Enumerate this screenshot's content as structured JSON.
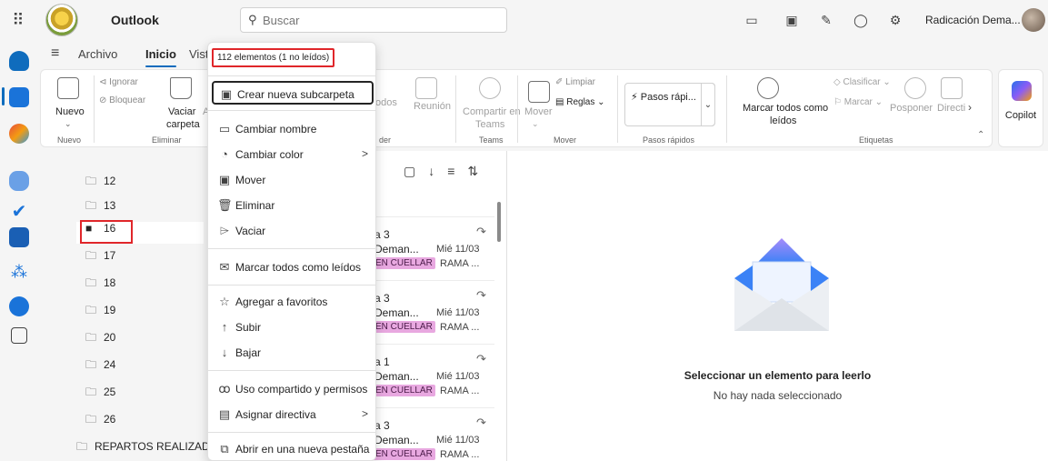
{
  "app": {
    "title": "Outlook",
    "account": "Radicación Dema..."
  },
  "search": {
    "placeholder": "Buscar",
    "icon": "search-icon"
  },
  "ribbon": {
    "tabs": [
      "Archivo",
      "Inicio",
      "Vist"
    ],
    "nuevo": "Nuevo",
    "nuevo_group": "Nuevo",
    "ignorar": "Ignorar",
    "bloquear": "Bloquear",
    "vaciar": "Vaciar",
    "vaciar_carpeta": "carpeta",
    "vaciar_extra": "A",
    "eliminar_group": "Eliminar",
    "todos": "odos",
    "reunion": "Reunión",
    "responder_group": "der",
    "compartir_teams": "Compartir en",
    "compartir_teams2": "Teams",
    "teams_group": "Teams",
    "mover": "Mover",
    "limpiar": "Limpiar",
    "reglas": "Reglas",
    "mover_group": "Mover",
    "pasos_rapidos_btn": "Pasos rápi...",
    "pasos_rapidos_group": "Pasos rápidos",
    "marcar_todos": "Marcar todos como",
    "marcar_todos2": "leídos",
    "clasificar": "Clasificar",
    "marcar": "Marcar",
    "posponer": "Posponer",
    "directiva": "Directi",
    "etiquetas_group": "Etiquetas",
    "copilot": "Copilot"
  },
  "folders": [
    {
      "name": "12"
    },
    {
      "name": "13"
    },
    {
      "name": "16",
      "selected": true
    },
    {
      "name": "17"
    },
    {
      "name": "18"
    },
    {
      "name": "19"
    },
    {
      "name": "20"
    },
    {
      "name": "24"
    },
    {
      "name": "25"
    },
    {
      "name": "26"
    },
    {
      "name": "REPARTOS REALIZADOS"
    }
  ],
  "messages": [
    {
      "line1": "a 3",
      "line2": "Deman...",
      "date": "Mié 11/03",
      "tag": "EN CUELLAR",
      "rama": "RAMA ..."
    },
    {
      "line1": "a 3",
      "line2": "Deman...",
      "date": "Mié 11/03",
      "tag": "EN CUELLAR",
      "rama": "RAMA ..."
    },
    {
      "line1": "a 1",
      "line2": "Deman...",
      "date": "Mié 11/03",
      "tag": "EN CUELLAR",
      "rama": "RAMA ..."
    },
    {
      "line1": "a 3",
      "line2": "Deman...",
      "date": "Mié 11/03",
      "tag": "EN CUELLAR",
      "rama": "RAMA ..."
    }
  ],
  "context_menu": {
    "count": "112 elementos (1 no leídos)",
    "items": [
      {
        "label": "Crear nueva subcarpeta",
        "icon": "new-folder-icon"
      },
      {
        "label": "Cambiar nombre",
        "icon": "rename-icon"
      },
      {
        "label": "Cambiar color",
        "icon": "palette-icon",
        "submenu": true
      },
      {
        "label": "Mover",
        "icon": "move-folder-icon"
      },
      {
        "label": "Eliminar",
        "icon": "trash-icon"
      },
      {
        "label": "Vaciar",
        "icon": "empty-icon"
      },
      {
        "label": "Marcar todos como leídos",
        "icon": "mark-read-icon"
      },
      {
        "label": "Agregar a favoritos",
        "icon": "star-icon"
      },
      {
        "label": "Subir",
        "icon": "arrow-up-icon"
      },
      {
        "label": "Bajar",
        "icon": "arrow-down-icon"
      },
      {
        "label": "Uso compartido y permisos",
        "icon": "people-icon"
      },
      {
        "label": "Asignar directiva",
        "icon": "policy-icon",
        "submenu": true
      },
      {
        "label": "Abrir en una nueva pestaña",
        "icon": "open-tab-icon"
      }
    ]
  },
  "reading_pane": {
    "title": "Seleccionar un elemento para leerlo",
    "subtitle": "No hay nada seleccionado"
  },
  "colors": {
    "accent": "#0f6cbd",
    "highlight_red": "#e0262a",
    "tag_pink": "#e8a8e0"
  }
}
